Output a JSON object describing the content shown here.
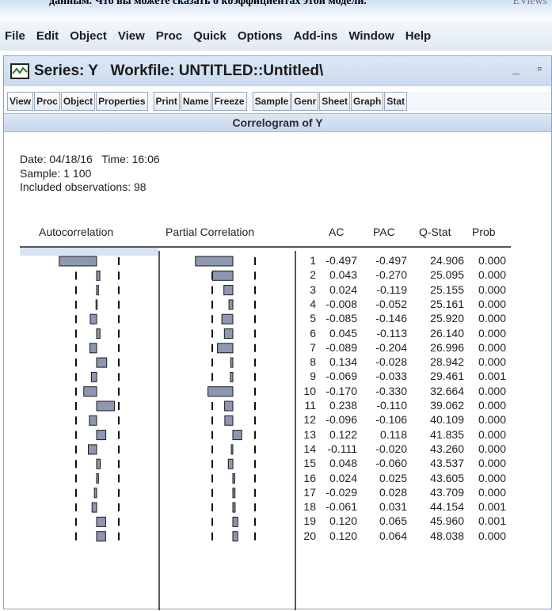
{
  "caption": {
    "text": "данным. Что вы можете сказать о коэффициентах этой модели.",
    "right_text": "EViews"
  },
  "menu": [
    "File",
    "Edit",
    "Object",
    "View",
    "Proc",
    "Quick",
    "Options",
    "Add-ins",
    "Window",
    "Help"
  ],
  "window": {
    "title": "Series: Y   Workfile: UNTITLED::Untitled\\",
    "minimize": "_",
    "maximize": "▫"
  },
  "toolbar": [
    "View",
    "Proc",
    "Object",
    "Properties",
    "Print",
    "Name",
    "Freeze",
    "Sample",
    "Genr",
    "Sheet",
    "Graph",
    "Stat"
  ],
  "view_title": "Correlogram of Y",
  "info": {
    "date_line": "Date: 04/18/16   Time: 16:06",
    "sample_line": "Sample: 1 100",
    "obs_line": "Included observations: 98"
  },
  "headers": {
    "autocorrelation": "Autocorrelation",
    "partial_correlation": "Partial Correlation",
    "ac": "AC",
    "pac": "PAC",
    "qstat": "Q-Stat",
    "prob": "Prob"
  },
  "rows": [
    {
      "lag": "1",
      "ac": "-0.497",
      "pac": "-0.497",
      "q": "24.906",
      "prob": "0.000"
    },
    {
      "lag": "2",
      "ac": "0.043",
      "pac": "-0.270",
      "q": "25.095",
      "prob": "0.000"
    },
    {
      "lag": "3",
      "ac": "0.024",
      "pac": "-0.119",
      "q": "25.155",
      "prob": "0.000"
    },
    {
      "lag": "4",
      "ac": "-0.008",
      "pac": "-0.052",
      "q": "25.161",
      "prob": "0.000"
    },
    {
      "lag": "5",
      "ac": "-0.085",
      "pac": "-0.146",
      "q": "25.920",
      "prob": "0.000"
    },
    {
      "lag": "6",
      "ac": "0.045",
      "pac": "-0.113",
      "q": "26.140",
      "prob": "0.000"
    },
    {
      "lag": "7",
      "ac": "-0.089",
      "pac": "-0.204",
      "q": "26.996",
      "prob": "0.000"
    },
    {
      "lag": "8",
      "ac": "0.134",
      "pac": "-0.028",
      "q": "28.942",
      "prob": "0.000"
    },
    {
      "lag": "9",
      "ac": "-0.069",
      "pac": "-0.033",
      "q": "29.461",
      "prob": "0.001"
    },
    {
      "lag": "10",
      "ac": "-0.170",
      "pac": "-0.330",
      "q": "32.664",
      "prob": "0.000"
    },
    {
      "lag": "11",
      "ac": "0.238",
      "pac": "-0.110",
      "q": "39.062",
      "prob": "0.000"
    },
    {
      "lag": "12",
      "ac": "-0.096",
      "pac": "-0.106",
      "q": "40.109",
      "prob": "0.000"
    },
    {
      "lag": "13",
      "ac": "0.122",
      "pac": "0.118",
      "q": "41.835",
      "prob": "0.000"
    },
    {
      "lag": "14",
      "ac": "-0.111",
      "pac": "-0.020",
      "q": "43.260",
      "prob": "0.000"
    },
    {
      "lag": "15",
      "ac": "0.048",
      "pac": "-0.060",
      "q": "43.537",
      "prob": "0.000"
    },
    {
      "lag": "16",
      "ac": "0.024",
      "pac": "0.025",
      "q": "43.605",
      "prob": "0.000"
    },
    {
      "lag": "17",
      "ac": "-0.029",
      "pac": "0.028",
      "q": "43.709",
      "prob": "0.000"
    },
    {
      "lag": "18",
      "ac": "-0.061",
      "pac": "0.031",
      "q": "44.154",
      "prob": "0.001"
    },
    {
      "lag": "19",
      "ac": "0.120",
      "pac": "0.065",
      "q": "45.960",
      "prob": "0.001"
    },
    {
      "lag": "20",
      "ac": "0.120",
      "pac": "0.064",
      "q": "48.038",
      "prob": "0.000"
    }
  ],
  "colors": {
    "bar_fill": "#8d97b3",
    "bar_stroke": "#1a1a1a",
    "menu_bg": "#dfe8f3",
    "header_bg": "#c7d6ea"
  }
}
